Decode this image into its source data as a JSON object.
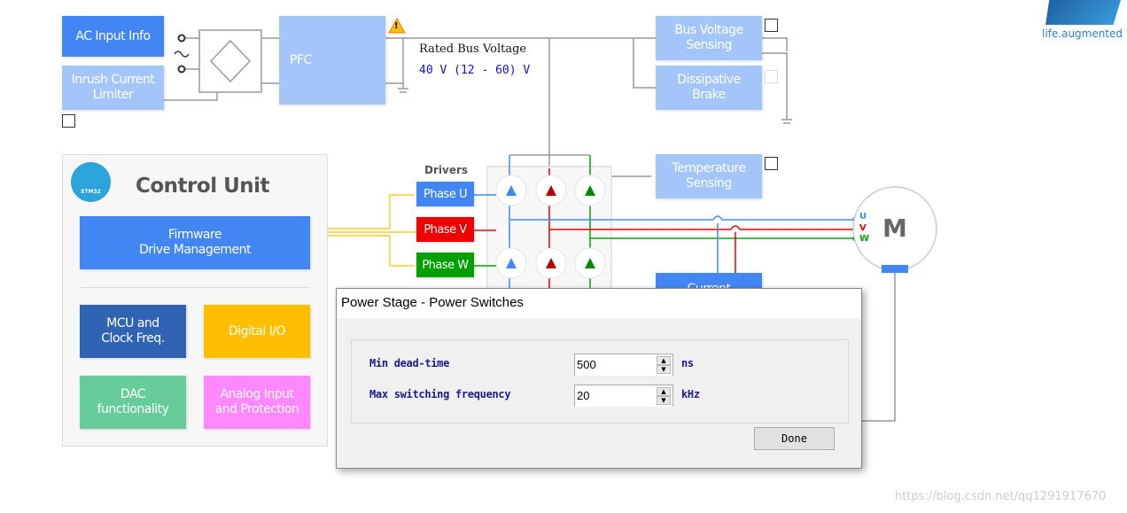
{
  "logo": {
    "brand": "ST",
    "tagline": "life.augmented"
  },
  "blocks": {
    "ac_input": "AC Input Info",
    "inrush": "Inrush Current\nLimiter",
    "pfc": "PFC",
    "bus_voltage_sensing": "Bus Voltage\nSensing",
    "dissipative_brake": "Dissipative\nBrake",
    "temperature_sensing": "Temperature\nSensing",
    "current_sensing": "Current"
  },
  "bus": {
    "label": "Rated Bus Voltage",
    "value": "40 V (12 - 60) V"
  },
  "drivers": {
    "title": "Drivers",
    "phases": [
      "Phase U",
      "Phase V",
      "Phase W"
    ]
  },
  "motor": {
    "label": "M",
    "terminals": [
      "U",
      "V",
      "W"
    ]
  },
  "control_unit": {
    "title": "Control Unit",
    "chip": "STM32",
    "firmware": "Firmware\nDrive Management",
    "mcu": "MCU and\nClock Freq.",
    "digital_io": "Digital I/O",
    "dac": "DAC\nfunctionality",
    "analog": "Analog Input\nand Protection"
  },
  "colors": {
    "blue": "#4286f4",
    "light_blue": "#a3c5f9",
    "red": "#f00000",
    "green": "#00a000",
    "yellow": "#ffbf00",
    "pink": "#ff88ff",
    "teal": "#66cc99",
    "navy": "#3163b5"
  },
  "dialog": {
    "title": "Power Stage - Power Switches",
    "fields": [
      {
        "label": "Min dead-time",
        "value": "500",
        "unit": "ns"
      },
      {
        "label": "Max switching frequency",
        "value": "20",
        "unit": "kHz"
      }
    ],
    "done": "Done"
  },
  "watermark": "https://blog.csdn.net/qq1291917670"
}
